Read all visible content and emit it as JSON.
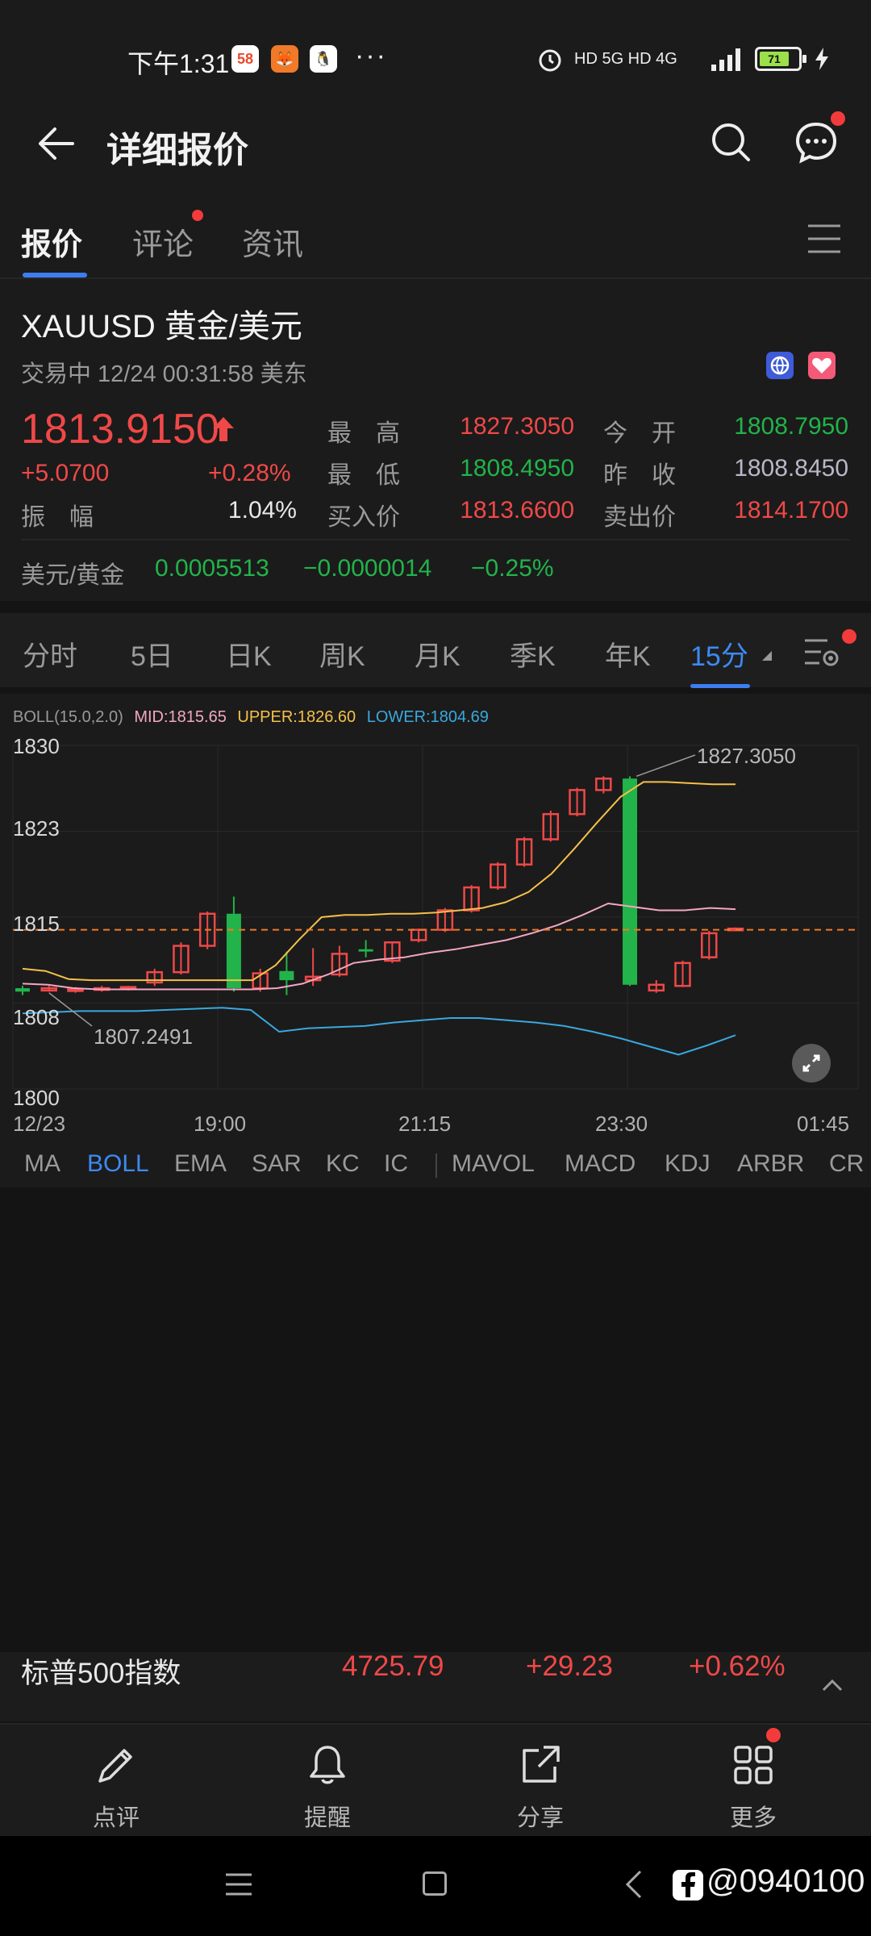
{
  "status_bar": {
    "time": "下午1:31",
    "apps": [
      "58",
      "🦊",
      "🐧"
    ],
    "more": "···",
    "network": "HD 5G HD 4G",
    "battery": "71"
  },
  "header": {
    "title": "详细报价"
  },
  "tabs": [
    {
      "label": "报价",
      "active": true
    },
    {
      "label": "评论",
      "active": false,
      "dot": true
    },
    {
      "label": "资讯",
      "active": false
    }
  ],
  "quote": {
    "symbol": "XAUUSD  黄金/美元",
    "status": "交易中   12/24 00:31:58 美东",
    "last_price": "1813.9150",
    "change": "+5.0700",
    "change_pct": "+0.28%",
    "amplitude_label": "振　幅",
    "amplitude": "1.04%",
    "high_label": "最　高",
    "high": "1827.3050",
    "low_label": "最　低",
    "low": "1808.4950",
    "bid_label": "买入价",
    "bid": "1813.6600",
    "open_label": "今　开",
    "open": "1808.7950",
    "prev_close_label": "昨　收",
    "prev_close": "1808.8450",
    "ask_label": "卖出价",
    "ask": "1814.1700"
  },
  "cross": {
    "label": "美元/黄金",
    "price": "0.0005513",
    "change": "−0.0000014",
    "change_pct": "−0.25%"
  },
  "period_tabs": [
    {
      "label": "分时"
    },
    {
      "label": "5日"
    },
    {
      "label": "日K"
    },
    {
      "label": "周K"
    },
    {
      "label": "月K"
    },
    {
      "label": "季K"
    },
    {
      "label": "年K"
    },
    {
      "label": "15分",
      "active": true
    }
  ],
  "boll_legend": {
    "name": "BOLL(15.0,2.0)",
    "mid": "MID:1815.65",
    "upper": "UPPER:1826.60",
    "lower": "LOWER:1804.69"
  },
  "chart_data": {
    "type": "candlestick",
    "y_ticks": [
      "1830",
      "1823",
      "1815",
      "1808",
      "1800"
    ],
    "x_ticks": [
      "12/23",
      "19:00",
      "21:15",
      "23:30",
      "01:45"
    ],
    "ylim": [
      1800,
      1830
    ],
    "high_annotation": "1827.3050",
    "low_annotation": "1807.2491",
    "current_price_line": 1813.9,
    "candles": [
      {
        "o": 1808.5,
        "h": 1809.0,
        "l": 1808.2,
        "c": 1808.8,
        "up": false
      },
      {
        "o": 1808.8,
        "h": 1809.0,
        "l": 1808.5,
        "c": 1808.6,
        "up": true
      },
      {
        "o": 1808.6,
        "h": 1808.9,
        "l": 1808.4,
        "c": 1808.7,
        "up": true
      },
      {
        "o": 1808.7,
        "h": 1809.0,
        "l": 1808.5,
        "c": 1808.8,
        "up": true
      },
      {
        "o": 1808.8,
        "h": 1809.0,
        "l": 1808.6,
        "c": 1808.9,
        "up": true
      },
      {
        "o": 1809.3,
        "h": 1810.5,
        "l": 1809.0,
        "c": 1810.2,
        "up": true
      },
      {
        "o": 1810.2,
        "h": 1812.8,
        "l": 1810.0,
        "c": 1812.5,
        "up": true
      },
      {
        "o": 1812.5,
        "h": 1815.5,
        "l": 1812.2,
        "c": 1815.3,
        "up": true
      },
      {
        "o": 1815.3,
        "h": 1816.8,
        "l": 1808.5,
        "c": 1808.8,
        "up": false
      },
      {
        "o": 1808.8,
        "h": 1810.5,
        "l": 1808.5,
        "c": 1810.1,
        "up": true
      },
      {
        "o": 1810.3,
        "h": 1812.0,
        "l": 1808.2,
        "c": 1809.5,
        "up": false
      },
      {
        "o": 1809.5,
        "h": 1812.3,
        "l": 1809.0,
        "c": 1809.8,
        "up": true
      },
      {
        "o": 1810.0,
        "h": 1812.5,
        "l": 1809.8,
        "c": 1811.8,
        "up": true
      },
      {
        "o": 1812.0,
        "h": 1813.0,
        "l": 1811.5,
        "c": 1812.2,
        "up": false
      },
      {
        "o": 1811.2,
        "h": 1812.8,
        "l": 1811.0,
        "c": 1812.8,
        "up": true
      },
      {
        "o": 1813.0,
        "h": 1814.0,
        "l": 1812.8,
        "c": 1813.9,
        "up": true
      },
      {
        "o": 1813.9,
        "h": 1815.8,
        "l": 1813.7,
        "c": 1815.6,
        "up": true
      },
      {
        "o": 1815.6,
        "h": 1817.8,
        "l": 1815.4,
        "c": 1817.6,
        "up": true
      },
      {
        "o": 1817.6,
        "h": 1819.8,
        "l": 1817.4,
        "c": 1819.6,
        "up": true
      },
      {
        "o": 1819.6,
        "h": 1822.0,
        "l": 1819.4,
        "c": 1821.8,
        "up": true
      },
      {
        "o": 1821.8,
        "h": 1824.3,
        "l": 1821.6,
        "c": 1824.0,
        "up": true
      },
      {
        "o": 1824.0,
        "h": 1826.3,
        "l": 1823.8,
        "c": 1826.1,
        "up": true
      },
      {
        "o": 1826.1,
        "h": 1827.3,
        "l": 1825.8,
        "c": 1827.1,
        "up": true
      },
      {
        "o": 1827.1,
        "h": 1827.3,
        "l": 1809.0,
        "c": 1809.1,
        "up": false
      },
      {
        "o": 1809.1,
        "h": 1809.5,
        "l": 1808.4,
        "c": 1808.6,
        "up": true
      },
      {
        "o": 1809.0,
        "h": 1811.2,
        "l": 1808.9,
        "c": 1811.0,
        "up": true
      },
      {
        "o": 1811.5,
        "h": 1813.8,
        "l": 1811.3,
        "c": 1813.6,
        "up": true
      },
      {
        "o": 1813.9,
        "h": 1814.1,
        "l": 1813.8,
        "c": 1814.0,
        "up": true
      }
    ],
    "boll_upper": [
      1810.5,
      1810.3,
      1809.6,
      1809.5,
      1809.5,
      1809.5,
      1809.5,
      1809.5,
      1809.5,
      1809.5,
      1809.5,
      1810.8,
      1813.0,
      1815.0,
      1815.2,
      1815.2,
      1815.3,
      1815.3,
      1815.4,
      1815.6,
      1815.8,
      1816.3,
      1817.2,
      1818.8,
      1821.0,
      1823.3,
      1825.5,
      1826.8,
      1826.8,
      1826.7,
      1826.6,
      1826.6
    ],
    "boll_mid": [
      1809.2,
      1809.1,
      1808.8,
      1808.7,
      1808.7,
      1808.7,
      1808.7,
      1808.7,
      1808.7,
      1808.7,
      1808.8,
      1809.2,
      1810.0,
      1811.0,
      1811.3,
      1811.5,
      1811.9,
      1812.2,
      1812.6,
      1813.0,
      1813.6,
      1814.3,
      1815.2,
      1816.2,
      1815.9,
      1815.6,
      1815.6,
      1815.8,
      1815.7
    ],
    "boll_lower": [
      1806.6,
      1806.7,
      1806.8,
      1806.8,
      1806.8,
      1806.9,
      1807.0,
      1807.1,
      1806.9,
      1805.0,
      1805.3,
      1805.4,
      1805.5,
      1805.8,
      1806.0,
      1806.2,
      1806.2,
      1806.0,
      1805.8,
      1805.5,
      1805.0,
      1804.4,
      1803.7,
      1803.0,
      1803.8,
      1804.7
    ],
    "grid": true
  },
  "indicators": [
    {
      "label": "MA"
    },
    {
      "label": "BOLL",
      "active": true
    },
    {
      "label": "EMA"
    },
    {
      "label": "SAR"
    },
    {
      "label": "KC"
    },
    {
      "label": "IC"
    },
    {
      "label": "MAVOL"
    },
    {
      "label": "MACD"
    },
    {
      "label": "KDJ"
    },
    {
      "label": "ARBR"
    },
    {
      "label": "CR"
    }
  ],
  "ticker": {
    "name": "标普500指数",
    "price": "4725.79",
    "change": "+29.23",
    "change_pct": "+0.62%"
  },
  "actions": [
    {
      "label": "点评",
      "icon": "pencil-icon"
    },
    {
      "label": "提醒",
      "icon": "bell-icon"
    },
    {
      "label": "分享",
      "icon": "share-icon"
    },
    {
      "label": "更多",
      "icon": "grid-icon"
    }
  ],
  "watermark": "@0940100",
  "colors": {
    "up": "#f04848",
    "down": "#22b34a",
    "accent": "#3d7df0",
    "boll_upper": "#f5c04a",
    "boll_mid": "#f3a7c2",
    "boll_lower": "#3aa8de"
  }
}
